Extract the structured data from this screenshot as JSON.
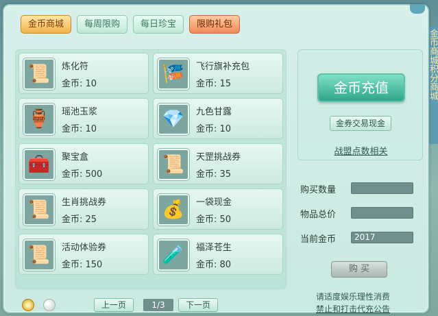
{
  "tabs": [
    {
      "label": "金币商城",
      "active": true
    },
    {
      "label": "每周限购",
      "active": false
    },
    {
      "label": "每日珍宝",
      "active": false
    },
    {
      "label": "限购礼包",
      "active": false
    }
  ],
  "items": [
    {
      "name": "炼化符",
      "price": "金币: 10",
      "icon": "talisman-icon"
    },
    {
      "name": "飞行旗补充包",
      "price": "金币: 15",
      "icon": "flag-pack-icon"
    },
    {
      "name": "瑶池玉浆",
      "price": "金币: 10",
      "icon": "jade-jar-icon"
    },
    {
      "name": "九色甘露",
      "price": "金币: 10",
      "icon": "dew-crystal-icon"
    },
    {
      "name": "聚宝盒",
      "price": "金币: 500",
      "icon": "treasure-box-icon"
    },
    {
      "name": "天罡挑战券",
      "price": "金币: 35",
      "icon": "scroll-icon"
    },
    {
      "name": "生肖挑战券",
      "price": "金币: 25",
      "icon": "scroll-icon"
    },
    {
      "name": "一袋现金",
      "price": "金币: 50",
      "icon": "money-bag-icon"
    },
    {
      "name": "活动体验券",
      "price": "金币: 150",
      "icon": "scroll-icon"
    },
    {
      "name": "福泽苍生",
      "price": "金币: 80",
      "icon": "potion-icon"
    }
  ],
  "right_panel": {
    "recharge_label": "金币充值",
    "exchange_label": "金券交易现金",
    "points_link": "战盟点数相关",
    "qty_label": "购买数量",
    "qty_value": "",
    "total_label": "物品总价",
    "total_value": "",
    "current_label": "当前金币",
    "current_value": "2017",
    "buy_label": "购 买"
  },
  "pager": {
    "prev_label": "上一页",
    "page_text": "1/3",
    "next_label": "下一页"
  },
  "notice": {
    "line1": "请适度娱乐理性消费",
    "line2": "禁止和打击代充公告"
  },
  "side_text": "金币商城积分商城"
}
